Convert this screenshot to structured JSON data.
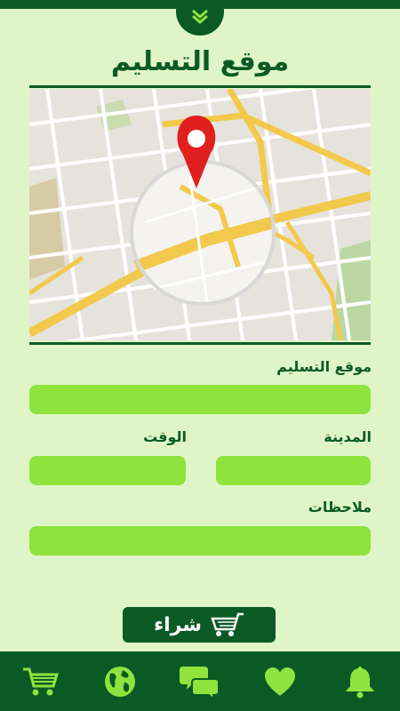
{
  "header": {
    "title": "موقع التسليم"
  },
  "form": {
    "delivery_location_label": "موقع التسليم",
    "city_label": "المدينة",
    "time_label": "الوقت",
    "notes_label": "ملاحظات"
  },
  "buy_button": {
    "label": "شراء",
    "icon": "cart-icon"
  },
  "bottom_nav": {
    "items": [
      {
        "icon": "cart-icon"
      },
      {
        "icon": "globe-icon"
      },
      {
        "icon": "chat-icon"
      },
      {
        "icon": "heart-icon"
      },
      {
        "icon": "bell-icon"
      }
    ]
  },
  "colors": {
    "background": "#dff5c8",
    "primary": "#0b5a25",
    "field": "#8fe33d",
    "nav_icon": "#8fe33d",
    "map_pin": "#e0201e"
  }
}
